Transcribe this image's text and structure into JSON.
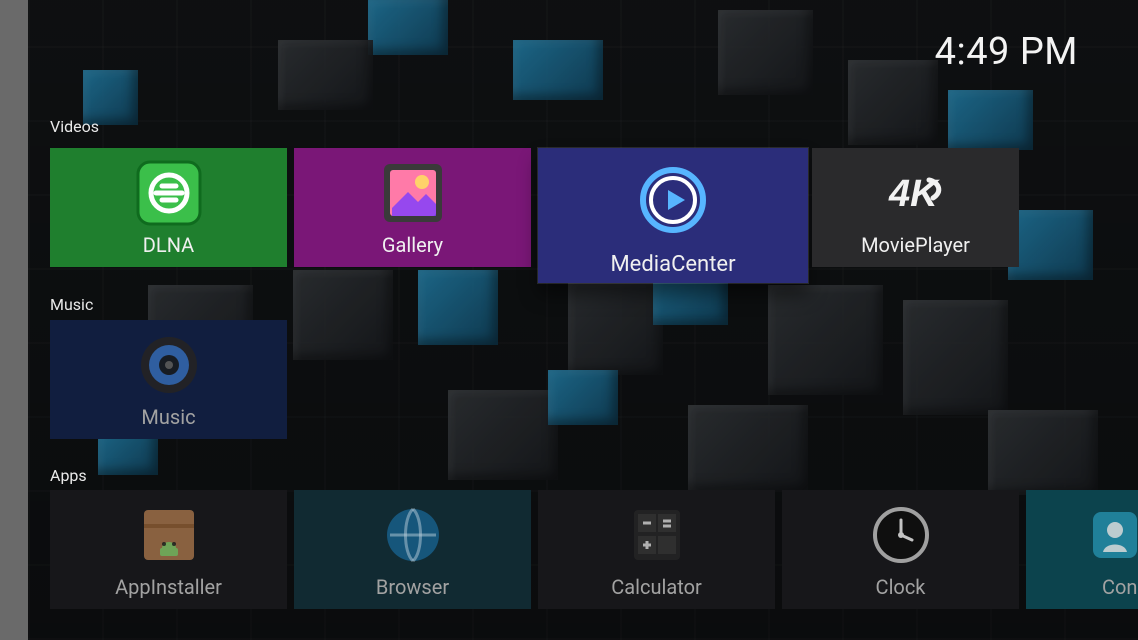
{
  "status": {
    "time": "4:49 PM"
  },
  "sections": {
    "videos": {
      "title": "Videos"
    },
    "music": {
      "title": "Music"
    },
    "apps": {
      "title": "Apps"
    }
  },
  "tiles": {
    "videos": [
      {
        "label": "DLNA",
        "color": "#1f7f2e"
      },
      {
        "label": "Gallery",
        "color": "#7a1777"
      },
      {
        "label": "MediaCenter",
        "color": "#2b2d7a"
      },
      {
        "label": "MoviePlayer",
        "color": "#2a2a2c"
      }
    ],
    "music": [
      {
        "label": "Music",
        "color": "#15244a"
      }
    ],
    "apps": [
      {
        "label": "AppInstaller",
        "color": "#1c1c1f"
      },
      {
        "label": "Browser",
        "color": "#15323b"
      },
      {
        "label": "Calculator",
        "color": "#1c1c1f"
      },
      {
        "label": "Clock",
        "color": "#1c1c1f"
      },
      {
        "label": "Con",
        "color": "#0f4f5b"
      }
    ]
  }
}
